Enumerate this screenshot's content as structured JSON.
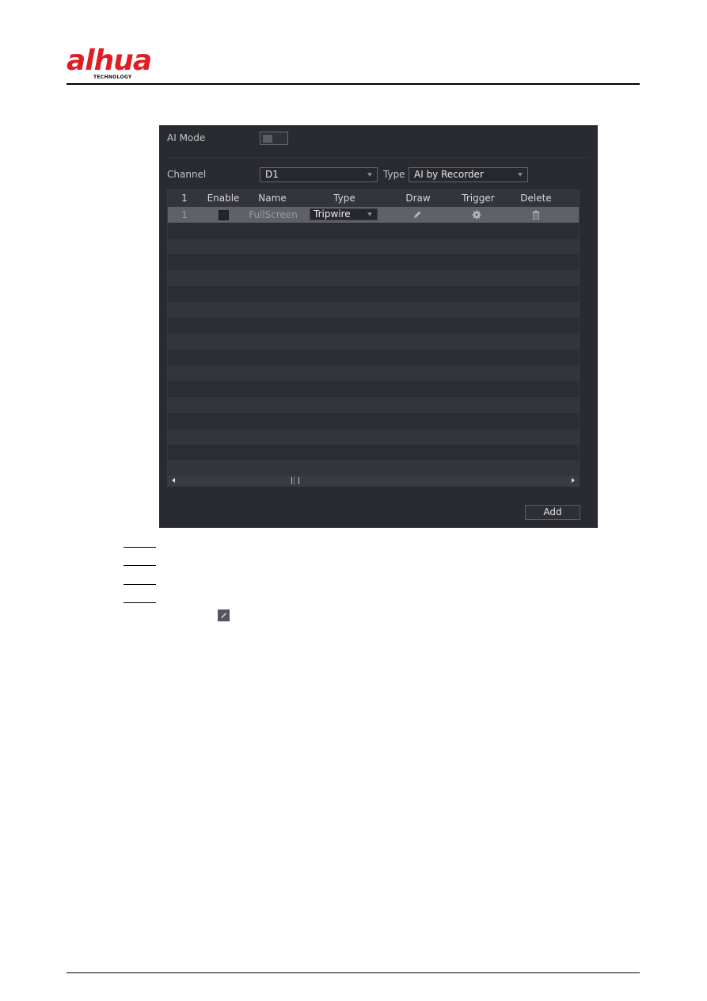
{
  "brand": {
    "logo_text": "alhua",
    "logo_subtext": "TECHNOLOGY",
    "brand_color": "#e11d24"
  },
  "panel": {
    "ai_mode": {
      "label": "AI Mode",
      "enabled": false
    },
    "channel": {
      "label": "Channel",
      "value": "D1"
    },
    "type": {
      "label": "Type",
      "value": "AI by Recorder"
    },
    "table": {
      "columns": [
        "1",
        "Enable",
        "Name",
        "Type",
        "Draw",
        "Trigger",
        "Delete"
      ],
      "rows": [
        {
          "index": "1",
          "enabled": false,
          "name": "FullScreen",
          "type": "Tripwire",
          "draw_icon": "pencil-icon",
          "trigger_icon": "gear-icon",
          "delete_icon": "trash-icon"
        }
      ],
      "empty_row_count": 16
    },
    "add_label": "Add",
    "colors": {
      "panel_bg": "#2a2b31",
      "row_even": "#33343c",
      "row_selected": "#5f6068"
    }
  },
  "steps": {
    "count": 4,
    "inline_icon": "pencil-icon"
  }
}
